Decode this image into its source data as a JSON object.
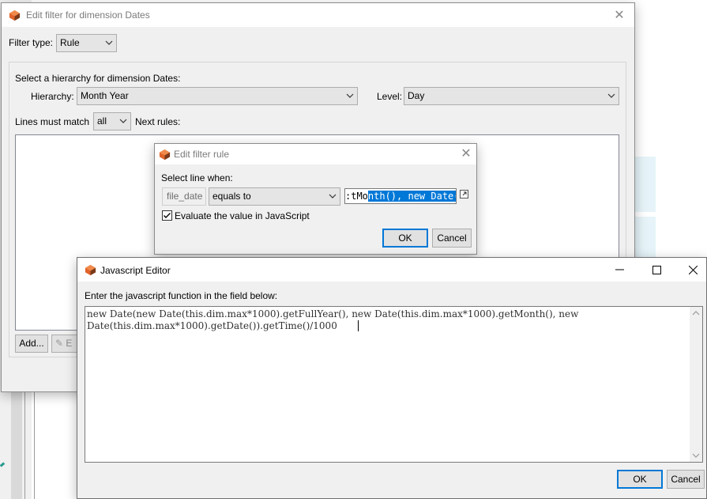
{
  "filter_dialog": {
    "title": "Edit filter for dimension Dates",
    "filter_type_label": "Filter type:",
    "filter_type_value": "Rule",
    "hierarchy_prompt": "Select a hierarchy for dimension Dates:",
    "hierarchy_label": "Hierarchy:",
    "hierarchy_value": "Month Year",
    "level_label": "Level:",
    "level_value": "Day",
    "match_label": "Lines must match",
    "match_value": "all",
    "next_rules_label": "Next rules:",
    "add_button": "Add...",
    "edit_button": "E"
  },
  "rule_dialog": {
    "title": "Edit filter rule",
    "select_line_label": "Select line when:",
    "field_name": "file_date",
    "operator_value": "equals to",
    "value_prefix": ":tMo",
    "value_selected": "nth(), new Date(",
    "javascript_checkbox_label": "Evaluate the value in JavaScript",
    "javascript_checked": true,
    "ok_button": "OK",
    "cancel_button": "Cancel"
  },
  "js_editor": {
    "title": "Javascript Editor",
    "instruction": "Enter the javascript function in the field below:",
    "code": "new Date(new Date(this.dim.max*1000).getFullYear(), new Date(this.dim.max*1000).getMonth(), new\nDate(this.dim.max*1000).getDate()).getTime()/1000",
    "ok_button": "OK",
    "cancel_button": "Cancel",
    "minimize_icon": "minimize-icon",
    "maximize_icon": "maximize-icon",
    "close_icon": "close-icon"
  },
  "colors": {
    "selection": "#0078d7",
    "window_bg": "#f0f0f0",
    "accent_border": "#0078d7"
  }
}
